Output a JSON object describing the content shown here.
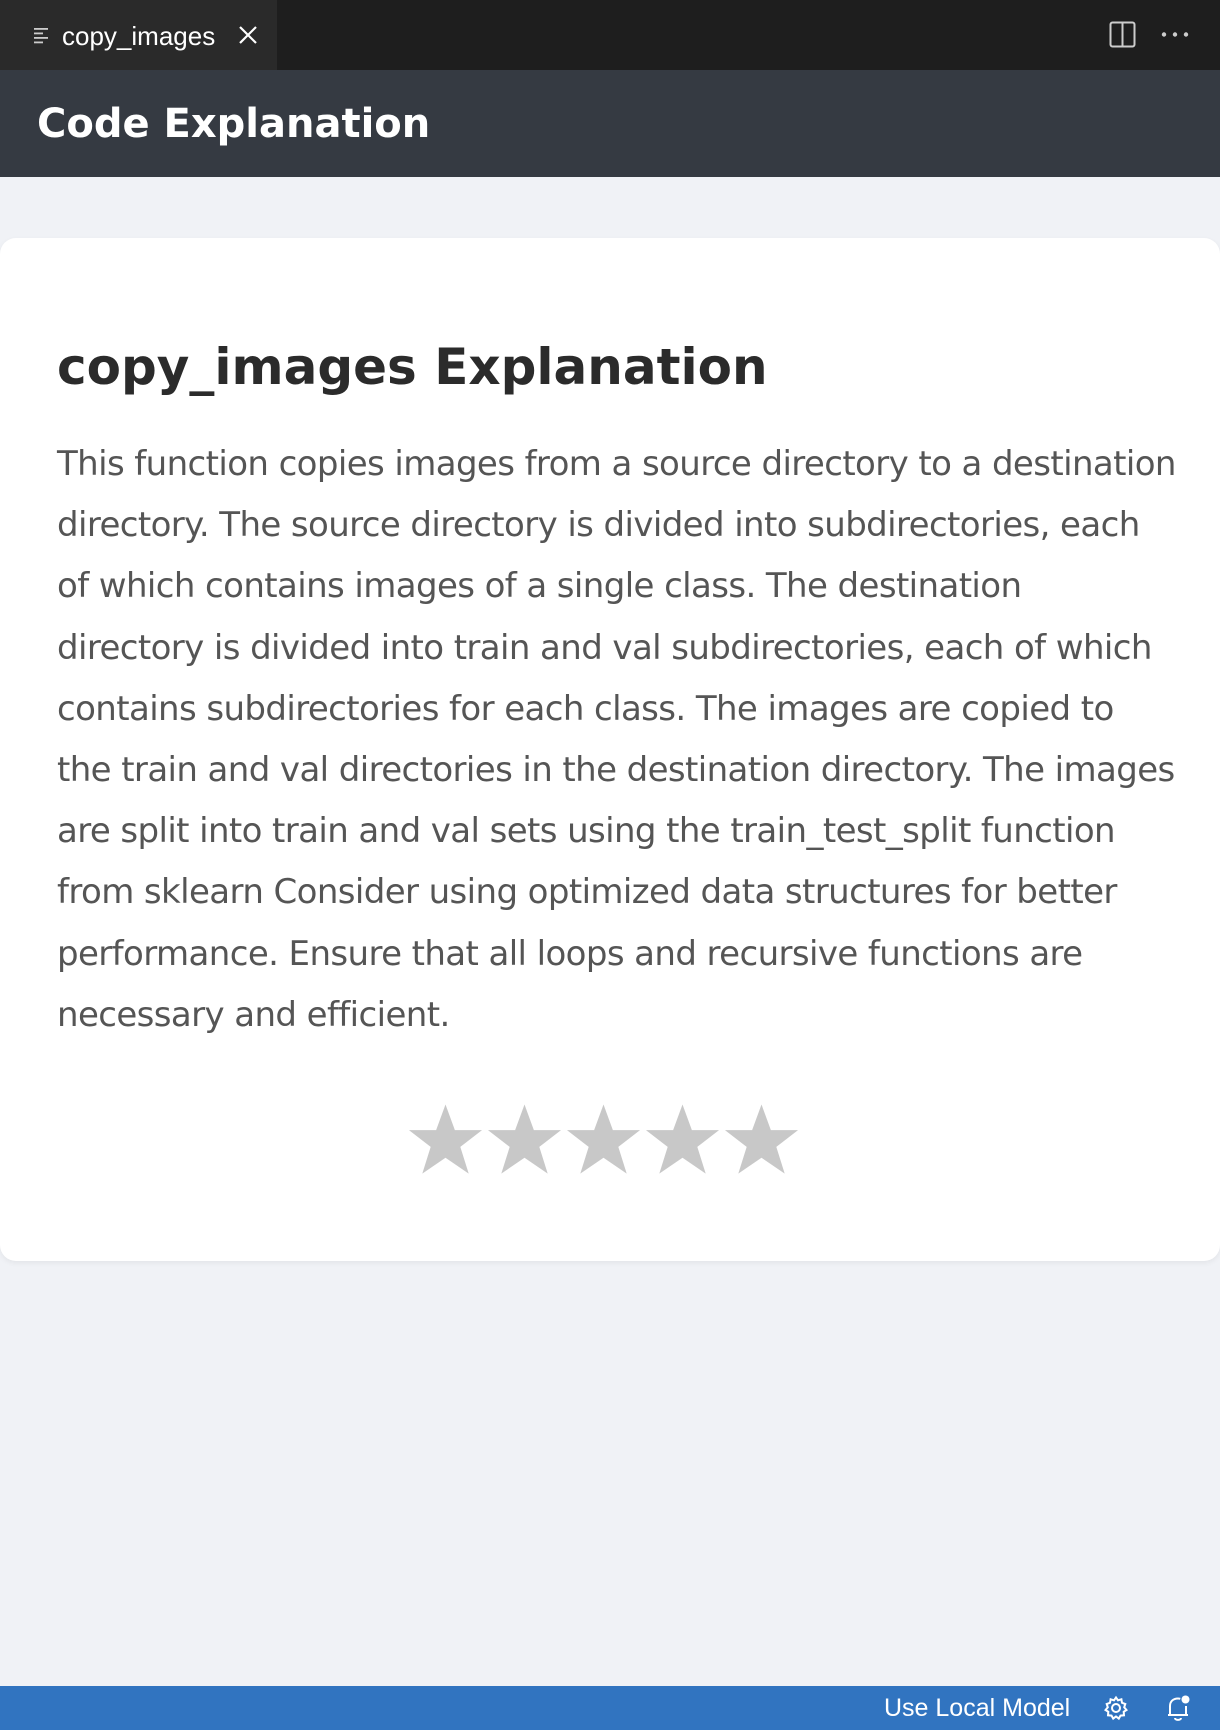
{
  "tab": {
    "label": "copy_images",
    "icon": "lines-icon",
    "close_icon": "close-icon"
  },
  "toolbar": {
    "split_editor_icon": "split-editor-icon",
    "more_actions_icon": "more-icon"
  },
  "header": {
    "title": "Code Explanation"
  },
  "card": {
    "title": "copy_images Explanation",
    "body": "This function copies images from a source directory to a destination directory. The source directory is divided into subdirectories, each of which contains images of a single class. The destination directory is divided into train and val subdirectories, each of which contains subdirectories for each class. The images are copied to the train and val directories in the destination directory. The images are split into train and val sets using the train_test_split function from sklearn Consider using optimized data structures for better performance. Ensure that all loops and recursive functions are necessary and efficient.",
    "rating": {
      "max": 5,
      "value": 0,
      "star_color": "#c8c8c8"
    }
  },
  "status_bar": {
    "model_label": "Use Local Model",
    "settings_icon": "gear-icon",
    "notifications_icon": "bell-icon",
    "color": "#3174c0"
  }
}
